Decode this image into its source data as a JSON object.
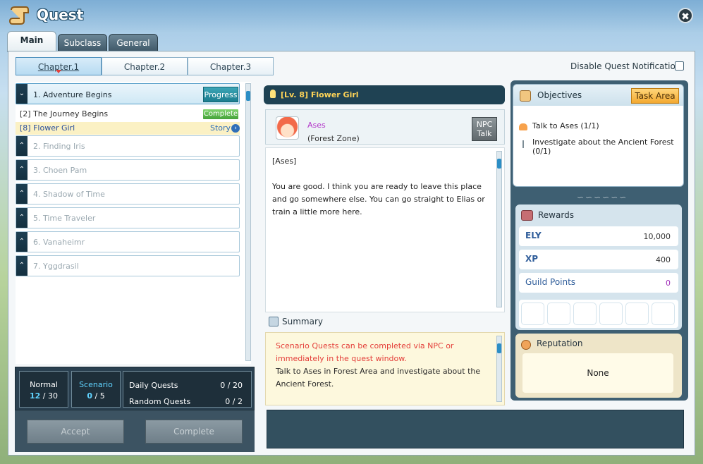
{
  "window": {
    "title": "Quest",
    "close_symbol": "✖"
  },
  "main_tabs": [
    {
      "label": "Main"
    },
    {
      "label": "Subclass"
    },
    {
      "label": "General"
    }
  ],
  "chapter_tabs": [
    {
      "label": "Chapter.1"
    },
    {
      "label": "Chapter.2"
    },
    {
      "label": "Chapter.3"
    }
  ],
  "disable_notification_label": "Disable Quest Notification",
  "chapters": [
    {
      "label": "1. Adventure Begins",
      "badge": "Progress"
    },
    {
      "label": "2. Finding Iris"
    },
    {
      "label": "3. Choen Pam"
    },
    {
      "label": "4. Shadow of Time"
    },
    {
      "label": "5. Time Traveler"
    },
    {
      "label": "6. Vanaheimr"
    },
    {
      "label": "7. Yggdrasil"
    }
  ],
  "quests": [
    {
      "label": "[2] The Journey Begins",
      "badge": "Complete"
    },
    {
      "label": "[8] Flower Girl",
      "tag": "Story"
    }
  ],
  "stats": {
    "normal": {
      "label": "Normal",
      "current": "12",
      "sep": "/",
      "total": "30"
    },
    "scenario": {
      "label": "Scenario",
      "current": "0",
      "sep": "/",
      "total": "5"
    },
    "daily": {
      "label": "Daily Quests",
      "value": "0 / 20"
    },
    "random": {
      "label": "Random Quests",
      "value": "0 / 2"
    }
  },
  "buttons": {
    "accept": "Accept",
    "complete": "Complete"
  },
  "quest_detail": {
    "header": "[Lv. 8] Flower Girl",
    "npc_name": "Ases",
    "npc_zone": "(Forest Zone)",
    "npc_talk_line1": "NPC",
    "npc_talk_line2": "Talk",
    "dialog_speaker": "[Ases]",
    "dialog_text": "You are good. I think you are ready to leave this place and go somewhere else. You can go straight to Elias or train a little more here.",
    "summary_label": "Summary",
    "summary_red": "Scenario Quests can be completed via NPC or immediately in the quest window.",
    "summary_text": "Talk to Ases in Forest Area and investigate about the Ancient Forest."
  },
  "objectives": {
    "title": "Objectives",
    "task_area_label": "Task Area",
    "items": [
      "Talk to Ases (1/1)",
      "Investigate about the Ancient Forest (0/1)"
    ]
  },
  "rewards": {
    "title": "Rewards",
    "ely": {
      "label": "ELY",
      "value": "10,000"
    },
    "xp": {
      "label": "XP",
      "value": "400"
    },
    "guild_points": {
      "label": "Guild Points",
      "value": "0"
    }
  },
  "reputation": {
    "title": "Reputation",
    "value": "None"
  },
  "colors": {
    "accent": "#1f4253",
    "tab_active": "#b7dbf2",
    "progress": "#1b7d8f",
    "complete": "#46a33a"
  }
}
